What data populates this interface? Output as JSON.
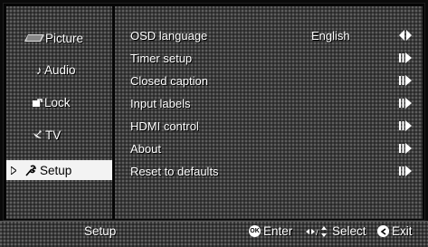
{
  "sidebar": {
    "items": [
      {
        "label": "Picture",
        "icon": "picture-icon"
      },
      {
        "label": "Audio",
        "icon": "music-note-icon"
      },
      {
        "label": "Lock",
        "icon": "lock-icon"
      },
      {
        "label": "TV",
        "icon": "satellite-dish-icon"
      },
      {
        "label": "Setup",
        "icon": "wrench-icon",
        "selected": true
      }
    ]
  },
  "menu": {
    "rows": [
      {
        "label": "OSD language",
        "value": "English",
        "arrow": "left-right-arrow-icon"
      },
      {
        "label": "Timer setup",
        "value": "",
        "arrow": "right-arrow-icon"
      },
      {
        "label": "Closed caption",
        "value": "",
        "arrow": "right-arrow-icon"
      },
      {
        "label": "Input labels",
        "value": "",
        "arrow": "right-arrow-icon"
      },
      {
        "label": "HDMI control",
        "value": "",
        "arrow": "right-arrow-icon"
      },
      {
        "label": "About",
        "value": "",
        "arrow": "right-arrow-icon"
      },
      {
        "label": "Reset to defaults",
        "value": "",
        "arrow": "right-arrow-icon"
      }
    ]
  },
  "footer": {
    "title": "Setup",
    "ok_badge": "OK",
    "enter_label": "Enter",
    "select_label": "Select",
    "exit_label": "Exit"
  }
}
